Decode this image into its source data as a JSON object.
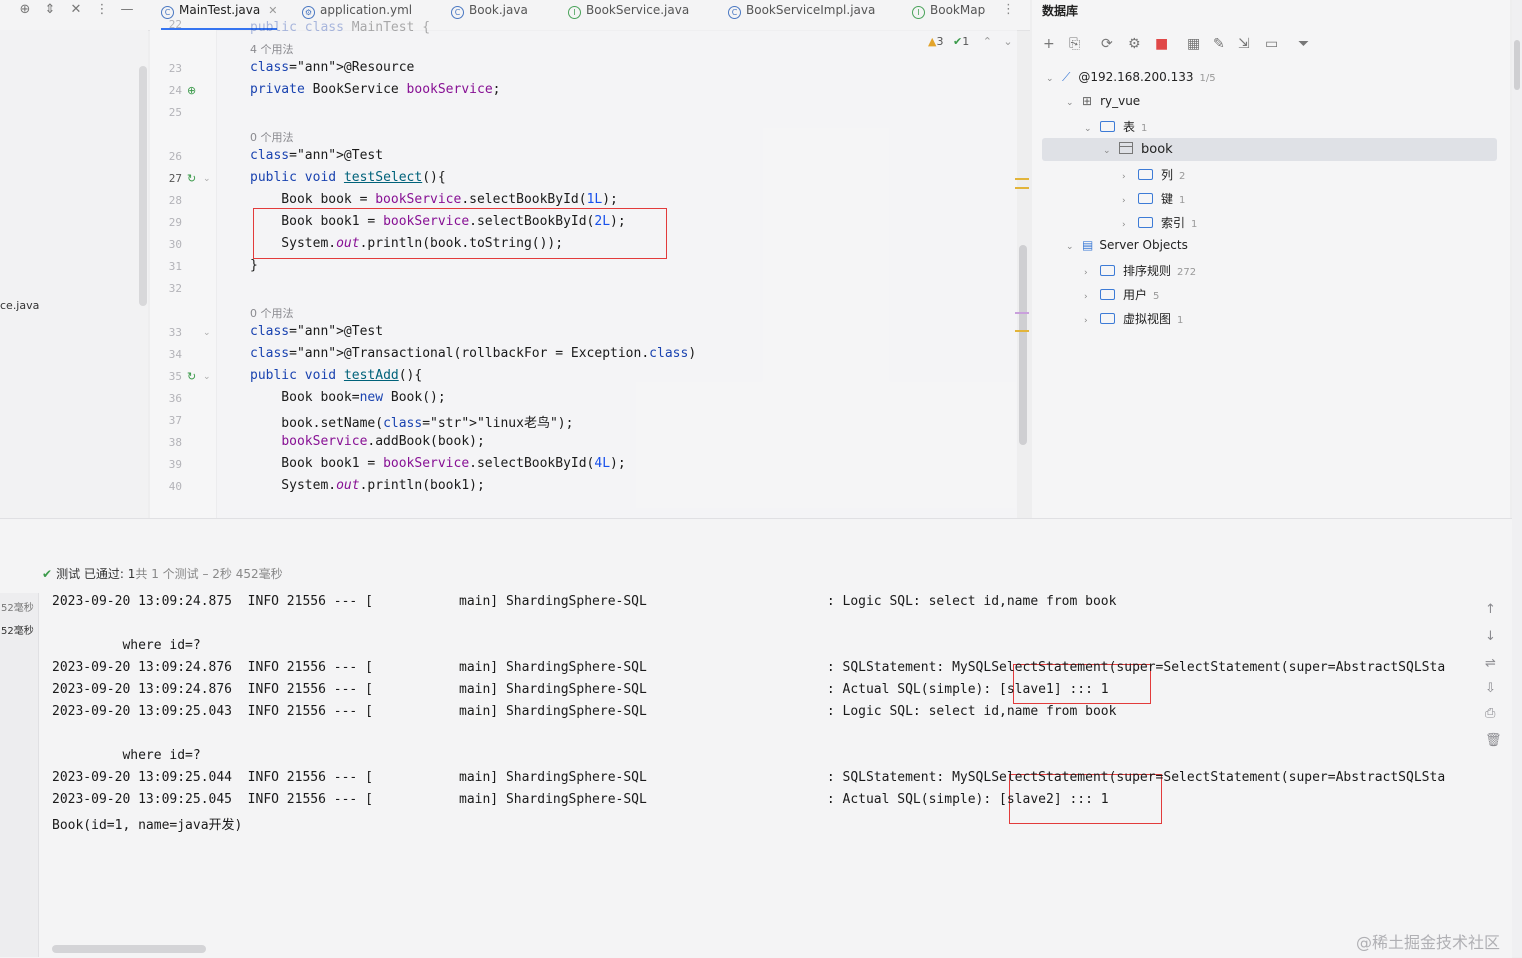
{
  "toolbar": {
    "icons": [
      "crosshair-icon",
      "expand-collapse-icon",
      "close-icon",
      "more-vertical-icon",
      "minimize-icon"
    ],
    "glyphs": [
      "⊕",
      "⇕",
      "✕",
      "⋮",
      "—"
    ]
  },
  "tabs": [
    {
      "label": "MainTest.java",
      "active": true,
      "icon": "class-icon"
    },
    {
      "label": "application.yml",
      "active": false,
      "icon": "yaml-icon"
    },
    {
      "label": "Book.java",
      "active": false,
      "icon": "class-icon"
    },
    {
      "label": "BookService.java",
      "active": false,
      "icon": "interface-icon"
    },
    {
      "label": "BookServiceImpl.java",
      "active": false,
      "icon": "class-icon"
    },
    {
      "label": "BookMap",
      "active": false,
      "icon": "interface-icon"
    }
  ],
  "left_panel": {
    "fragment": "ce.java"
  },
  "inspections": {
    "warnings": "3",
    "ok": "1"
  },
  "editor": {
    "lines": [
      {
        "n": "22",
        "hint": "",
        "code": "public class MainTest {"
      },
      {
        "n": "",
        "hint": "4 个用法",
        "code": ""
      },
      {
        "n": "23",
        "hint": "",
        "code": "@Resource"
      },
      {
        "n": "24",
        "hint": "",
        "code": "private BookService bookService;"
      },
      {
        "n": "25",
        "hint": "",
        "code": ""
      },
      {
        "n": "",
        "hint": "0 个用法",
        "code": ""
      },
      {
        "n": "26",
        "hint": "",
        "code": "@Test"
      },
      {
        "n": "27",
        "hint": "",
        "code": "public void testSelect(){"
      },
      {
        "n": "28",
        "hint": "",
        "code": "    Book book = bookService.selectBookById(1L);"
      },
      {
        "n": "29",
        "hint": "",
        "code": "    Book book1 = bookService.selectBookById(2L);"
      },
      {
        "n": "30",
        "hint": "",
        "code": "    System.out.println(book.toString());"
      },
      {
        "n": "31",
        "hint": "",
        "code": "}"
      },
      {
        "n": "32",
        "hint": "",
        "code": ""
      },
      {
        "n": "",
        "hint": "0 个用法",
        "code": ""
      },
      {
        "n": "33",
        "hint": "",
        "code": "@Test"
      },
      {
        "n": "34",
        "hint": "",
        "code": "@Transactional(rollbackFor = Exception.class)"
      },
      {
        "n": "35",
        "hint": "",
        "code": "public void testAdd(){"
      },
      {
        "n": "36",
        "hint": "",
        "code": "    Book book=new Book();"
      },
      {
        "n": "37",
        "hint": "",
        "code": "    book.setName(\"linux老鸟\");"
      },
      {
        "n": "38",
        "hint": "",
        "code": "    bookService.addBook(book);"
      },
      {
        "n": "39",
        "hint": "",
        "code": "    Book book1 = bookService.selectBookById(4L);"
      },
      {
        "n": "40",
        "hint": "",
        "code": "    System.out.println(book1);"
      }
    ]
  },
  "db_panel": {
    "title": "数据库",
    "tools": [
      "add-icon",
      "copy-icon",
      "refresh-icon",
      "settings-icon",
      "stop-icon",
      "table-icon",
      "edit-icon",
      "jump-icon",
      "console-icon",
      "filter-icon"
    ],
    "tool_glyphs": [
      "+",
      "⎘",
      "⟳",
      "⚙",
      "■",
      "▦",
      "✎",
      "⇲",
      "▭",
      "⏷"
    ],
    "tree": [
      {
        "label": "@192.168.200.133",
        "count": "1/5",
        "kind": "datasource",
        "arrow": "⌄"
      },
      {
        "label": "ry_vue",
        "count": "",
        "kind": "schema",
        "arrow": "⌄"
      },
      {
        "label": "表",
        "count": "1",
        "kind": "folder",
        "arrow": "⌄"
      },
      {
        "label": "book",
        "count": "",
        "kind": "table",
        "arrow": "⌄"
      },
      {
        "label": "列",
        "count": "2",
        "kind": "folder",
        "arrow": "›"
      },
      {
        "label": "键",
        "count": "1",
        "kind": "folder",
        "arrow": "›"
      },
      {
        "label": "索引",
        "count": "1",
        "kind": "folder",
        "arrow": "›"
      },
      {
        "label": "Server Objects",
        "count": "",
        "kind": "server",
        "arrow": "⌄"
      },
      {
        "label": "排序规则",
        "count": "272",
        "kind": "folder",
        "arrow": "›"
      },
      {
        "label": "用户",
        "count": "5",
        "kind": "folder",
        "arrow": "›"
      },
      {
        "label": "虚拟视图",
        "count": "1",
        "kind": "folder",
        "arrow": "›"
      }
    ]
  },
  "run": {
    "status_prefix": "测试 已通过: 1",
    "status_suffix": "共 1 个测试 – 2秒 452毫秒",
    "time_labels": [
      "52毫秒",
      "52毫秒"
    ],
    "log": [
      "2023-09-20 13:09:24.875  INFO 21556 --- [           main] ShardingSphere-SQL                       : Logic SQL: select id,name from book",
      "",
      "         where id=?",
      "2023-09-20 13:09:24.876  INFO 21556 --- [           main] ShardingSphere-SQL                       : SQLStatement: MySQLSelectStatement(super=SelectStatement(super=AbstractSQLSta",
      "2023-09-20 13:09:24.876  INFO 21556 --- [           main] ShardingSphere-SQL                       : Actual SQL(simple): [slave1] ::: 1",
      "2023-09-20 13:09:25.043  INFO 21556 --- [           main] ShardingSphere-SQL                       : Logic SQL: select id,name from book",
      "",
      "         where id=?",
      "2023-09-20 13:09:25.044  INFO 21556 --- [           main] ShardingSphere-SQL                       : SQLStatement: MySQLSelectStatement(super=SelectStatement(super=AbstractSQLSta",
      "2023-09-20 13:09:25.045  INFO 21556 --- [           main] ShardingSphere-SQL                       : Actual SQL(simple): [slave2] ::: 1",
      "Book(id=1, name=java开发)"
    ],
    "side_icons": [
      "arrow-up-icon",
      "arrow-down-icon",
      "soft-wrap-icon",
      "scroll-to-end-icon",
      "print-icon",
      "trash-icon"
    ],
    "side_glyphs": [
      "↑",
      "↓",
      "⇌",
      "⇩",
      "⎙",
      "🗑"
    ]
  },
  "watermark": "@稀土掘金技术社区"
}
